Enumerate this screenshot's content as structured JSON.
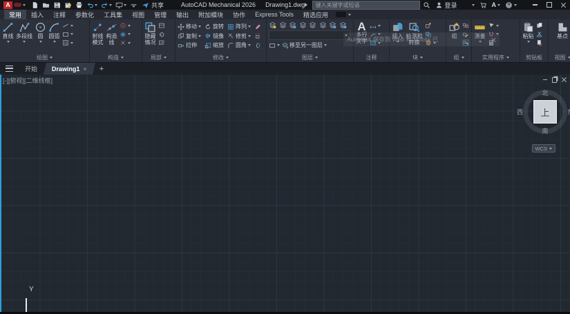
{
  "titlebar": {
    "logo_text": "A",
    "app_title": "AutoCAD Mechanical 2026",
    "doc_title": "Drawing1.dwg",
    "search_placeholder": "键入关键字或短语",
    "signin_label": "登录",
    "share_label": "共享",
    "appstore_label": "A"
  },
  "menubar": {
    "tabs": [
      "常用",
      "插入",
      "注释",
      "参数化",
      "工具集",
      "视图",
      "管理",
      "输出",
      "附加模块",
      "协作",
      "Express Tools",
      "精选应用"
    ],
    "active_tab": "常用"
  },
  "notification": {
    "text": "Autodesk 保存到 Web 和 Mobile 已"
  },
  "ribbon": {
    "panels": [
      {
        "label": "绘图",
        "big": [
          {
            "label": "直线",
            "icon": "line"
          },
          {
            "label": "多段线",
            "icon": "polyline"
          },
          {
            "label": "圆",
            "icon": "circle"
          },
          {
            "label": "圆弧",
            "icon": "arc"
          }
        ],
        "mini_icons": [
          "segment",
          "rect-tool",
          "hatch"
        ]
      },
      {
        "label": "构造",
        "big": [
          {
            "label": "射线模式",
            "icon": "ray"
          },
          {
            "label": "构造线",
            "icon": "xline"
          }
        ],
        "mini_icons": [
          "ccircle",
          "cstar",
          "cmark"
        ]
      },
      {
        "label": "局部",
        "big": [
          {
            "label": "隐藏情况",
            "icon": "hide-squares"
          }
        ],
        "mini_icons": [
          "detail-rect",
          "detail-update",
          "detail-view"
        ]
      },
      {
        "label": "修改",
        "buttons": [
          "移动",
          "旋转",
          "阵列",
          "复制",
          "镜像",
          "修剪",
          "拉伸",
          "缩放",
          "圆角"
        ],
        "mini_icons": [
          "erase",
          "explode",
          "offset"
        ]
      },
      {
        "label": "图层",
        "move_label": "移至另一图层",
        "layer_icons": [
          "layer-properties",
          "layer-off",
          "layer-freeze",
          "layer-lock",
          "layer-isolate",
          "layer-unisolate",
          "layer-previous",
          "layer-match"
        ]
      },
      {
        "label": "注释",
        "icon_text": "A",
        "big": [
          {
            "label": "多行文字",
            "icon": "mtext"
          }
        ],
        "mini_icons": [
          "dimension",
          "leader",
          "table"
        ]
      },
      {
        "label": "块",
        "big": [
          {
            "label": "插入",
            "icon": "insert-block"
          },
          {
            "label": "检测和转换",
            "icon": "detect"
          }
        ],
        "mini_icons": [
          "block-create",
          "block-edit",
          "shield"
        ]
      },
      {
        "label": "组",
        "big": [
          {
            "label": "组",
            "icon": "group"
          }
        ],
        "mini_icons": [
          "ungroup",
          "group-edit",
          "group-select"
        ]
      },
      {
        "label": "实用程序",
        "big": [
          {
            "label": "测量",
            "icon": "measure"
          }
        ],
        "mini_icons": [
          "quick-select",
          "snap-magnet",
          "calculator"
        ]
      },
      {
        "label": "剪贴板",
        "big": [
          {
            "label": "粘贴",
            "icon": "paste"
          }
        ],
        "mini_icons": [
          "clip-copy",
          "clip-cut",
          "clip-base"
        ]
      },
      {
        "label": "视图",
        "big": [
          {
            "label": "基点",
            "icon": "base-L"
          }
        ]
      }
    ]
  },
  "filetabs": {
    "start": "开始",
    "doc": "Drawing1",
    "close": "×",
    "add": "+"
  },
  "canvas": {
    "viewport_label": "[-][俯视][二维线框]",
    "viewcube": {
      "north": "北",
      "south": "南",
      "west": "西",
      "east": "东",
      "top": "上"
    },
    "wcs_label": "WCS",
    "ucs_y": "Y"
  },
  "colors": {
    "accent_blue": "#4da6dc",
    "logo_red": "#c1272d",
    "canvas_bg": "#212830",
    "ribbon_bg": "#2c313c",
    "accent_yellow": "#d9b84a"
  }
}
